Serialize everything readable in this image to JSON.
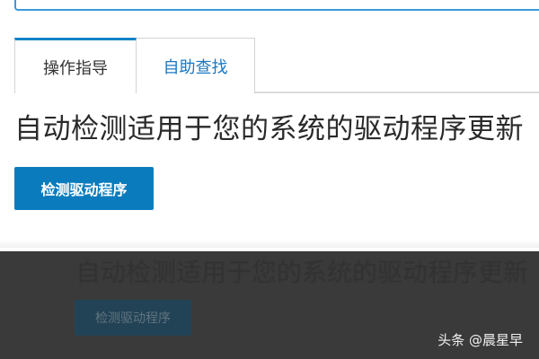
{
  "tabs": {
    "active_label": "操作指导",
    "inactive_label": "自助查找"
  },
  "main": {
    "heading": "自动检测适用于您的系统的驱动程序更新",
    "detect_button_label": "检测驱动程序"
  },
  "overlay": {
    "ghost_heading": "自动检测适用于您的系统的驱动程序更新",
    "ghost_button_label": "检测驱动程序",
    "watermark": "头条 @晨星早"
  },
  "colors": {
    "accent": "#1482c8",
    "button": "#0a7cbd",
    "tab_link": "#1a78c2",
    "overlay": "#3a3a3a"
  }
}
